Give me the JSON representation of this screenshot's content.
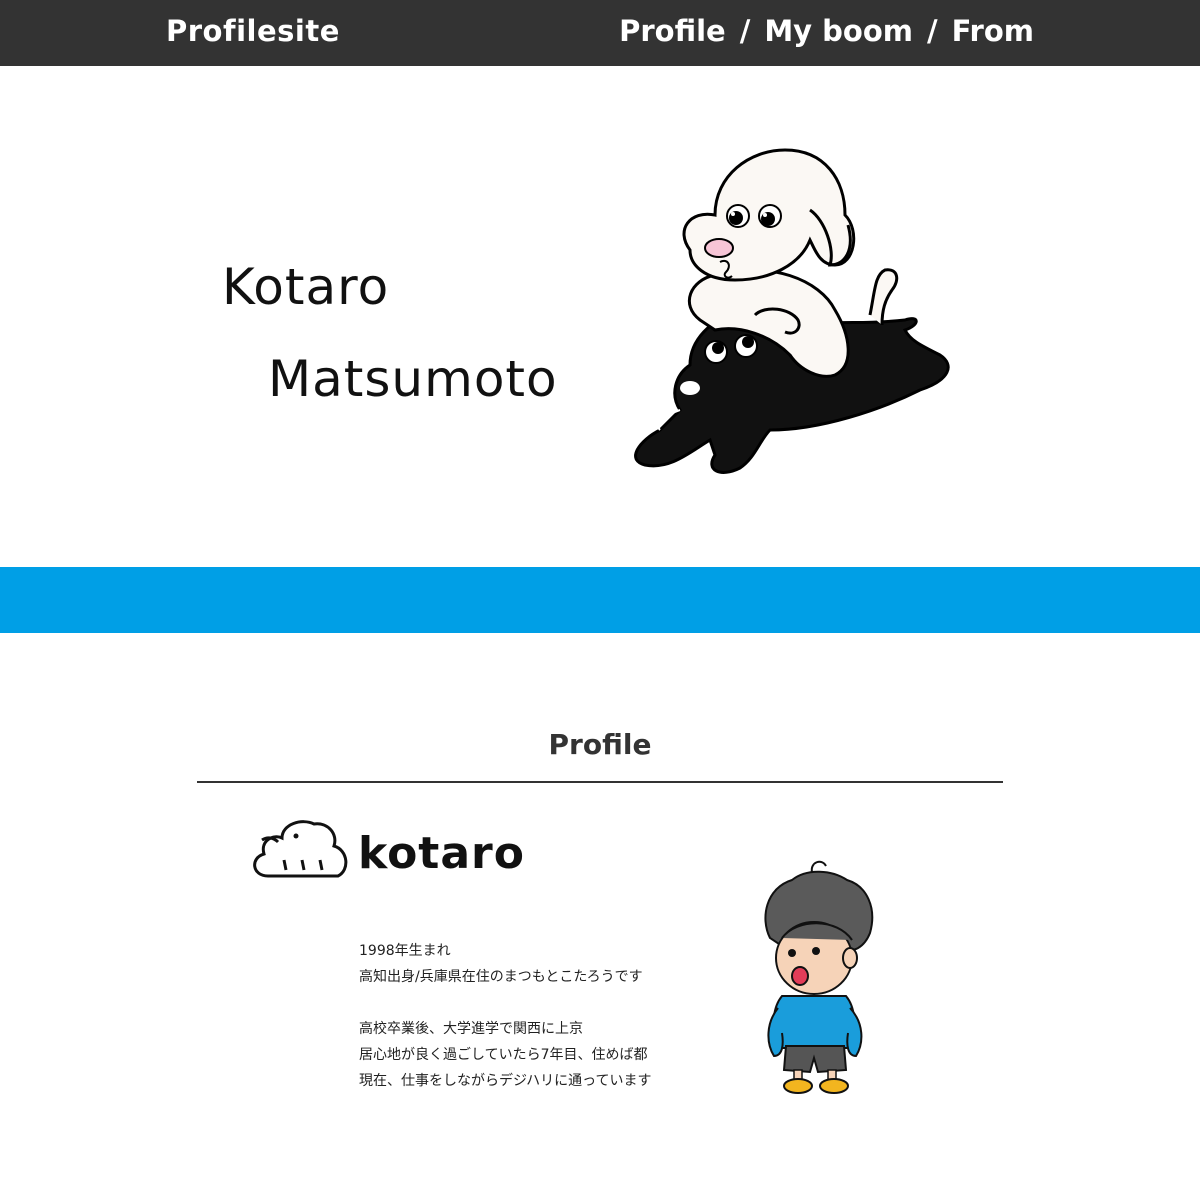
{
  "header": {
    "brand": "Profilesite",
    "nav": [
      {
        "label": "Profile"
      },
      {
        "label": "My boom"
      },
      {
        "label": "From"
      }
    ],
    "separator": "/"
  },
  "hero": {
    "first_name": "Kotaro",
    "last_name": "Matsumoto"
  },
  "colors": {
    "header_bg": "#333333",
    "accent_band": "#009fe6",
    "shirt": "#1a9ddb"
  },
  "profile": {
    "title": "Profile",
    "logo_text": "kotaro",
    "bio_lines": [
      "1998年生まれ",
      "高知出身/兵庫県在住のまつもとこたろうです",
      "",
      "高校卒業後、大学進学で関西に上京",
      "居心地が良く過ごしていたら7年目、住めば都",
      "現在、仕事をしながらデジハリに通っています"
    ]
  }
}
